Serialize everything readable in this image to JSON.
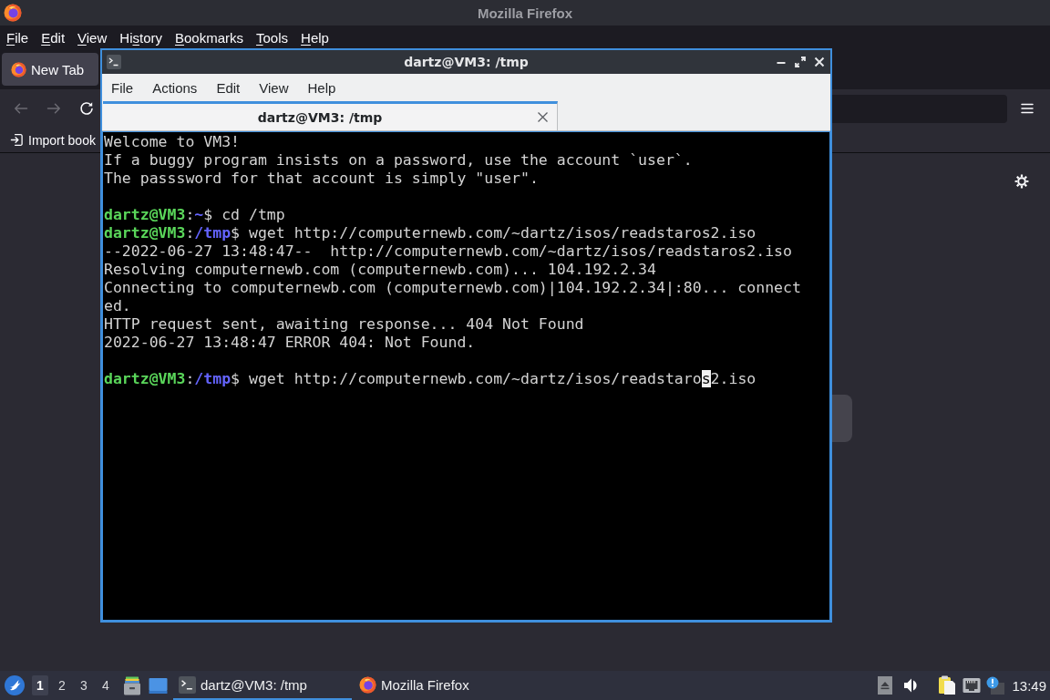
{
  "firefox": {
    "title": "Mozilla Firefox",
    "menu": [
      {
        "key": "F",
        "after": "ile"
      },
      {
        "key": "E",
        "after": "dit"
      },
      {
        "key": "V",
        "after": "iew"
      },
      {
        "before": "Hi",
        "key": "s",
        "after": "tory"
      },
      {
        "key": "B",
        "after": "ookmarks"
      },
      {
        "key": "T",
        "after": "ools"
      },
      {
        "key": "H",
        "after": "elp"
      }
    ],
    "tabs": [
      {
        "label": "New Tab",
        "selected": true
      }
    ],
    "nav_buttons": [
      {
        "kind": "back",
        "disabled": true
      },
      {
        "kind": "forward",
        "disabled": true
      },
      {
        "kind": "reload",
        "disabled": false
      }
    ],
    "bookmarks_toolbar": [
      {
        "label": "Import book"
      }
    ]
  },
  "terminal": {
    "title": "dartz@VM3: /tmp",
    "menu": [
      "File",
      "Actions",
      "Edit",
      "View",
      "Help"
    ],
    "tabs": [
      {
        "label": "dartz@VM3: /tmp",
        "selected": true
      }
    ],
    "lines": [
      {
        "kind": "text",
        "text": "Welcome to VM3!"
      },
      {
        "kind": "text",
        "text": "If a buggy program insists on a password, use the account `user`."
      },
      {
        "kind": "text",
        "text": "The passsword for that account is simply \"user\"."
      },
      {
        "kind": "blank"
      },
      {
        "kind": "prompt",
        "user_host": "dartz@VM3",
        "separator": ":",
        "path": "~",
        "input": "$ cd /tmp"
      },
      {
        "kind": "prompt",
        "user_host": "dartz@VM3",
        "separator": ":",
        "path": "/tmp",
        "input": "$ wget http://computernewb.com/~dartz/isos/readstaros2.iso"
      },
      {
        "kind": "text",
        "text": "--2022-06-27 13:48:47--  http://computernewb.com/~dartz/isos/readstaros2.iso"
      },
      {
        "kind": "text",
        "text": "Resolving computernewb.com (computernewb.com)... 104.192.2.34"
      },
      {
        "kind": "text",
        "text": "Connecting to computernewb.com (computernewb.com)|104.192.2.34|:80... connect"
      },
      {
        "kind": "text",
        "text": "ed."
      },
      {
        "kind": "text",
        "text": "HTTP request sent, awaiting response... 404 Not Found"
      },
      {
        "kind": "text",
        "text": "2022-06-27 13:48:47 ERROR 404: Not Found."
      },
      {
        "kind": "blank"
      },
      {
        "kind": "prompt",
        "user_host": "dartz@VM3",
        "separator": ":",
        "path": "/tmp",
        "input": "$ wget http://computernewb.com/~dartz/isos/readstaro",
        "cursor": "s",
        "after_cursor": "2.iso"
      }
    ]
  },
  "taskbar": {
    "desktops": [
      {
        "label": "1",
        "selected": true
      },
      {
        "label": "2",
        "selected": false
      },
      {
        "label": "3",
        "selected": false
      },
      {
        "label": "4",
        "selected": false
      }
    ],
    "tasks": [
      {
        "kind": "terminal",
        "label": "dartz@VM3: /tmp",
        "selected": true
      },
      {
        "kind": "browser",
        "label": "Mozilla Firefox",
        "selected": false
      }
    ],
    "clock": "13:49"
  }
}
